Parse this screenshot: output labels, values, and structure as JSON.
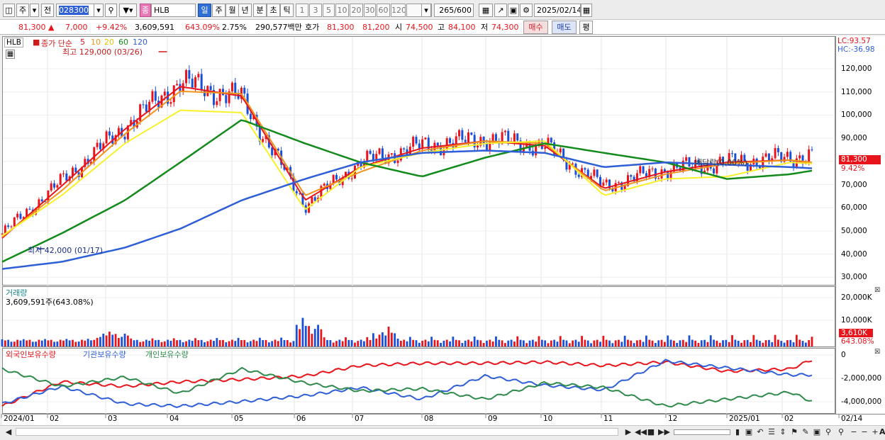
{
  "toolbar": {
    "acct_icon": "window-icon",
    "jugi_label": "주",
    "jeon_label": "전",
    "code_value": "028300",
    "search_icon": "search-icon",
    "zoom_icon": "zoom-icon",
    "speaker_icon": "speaker-icon",
    "badge": "종",
    "name_value": "HLB",
    "period_tabs": [
      {
        "label": "일"
      },
      {
        "label": "주"
      },
      {
        "label": "월"
      },
      {
        "label": "년"
      },
      {
        "label": "분"
      },
      {
        "label": "초"
      },
      {
        "label": "틱"
      }
    ],
    "interval_tabs": [
      {
        "label": "1"
      },
      {
        "label": "3"
      },
      {
        "label": "5"
      },
      {
        "label": "10"
      },
      {
        "label": "20"
      },
      {
        "label": "30"
      },
      {
        "label": "60"
      },
      {
        "label": "120"
      }
    ],
    "count_value": "265",
    "count_total": "/600",
    "date_value": "2025/02/14"
  },
  "quote": {
    "price": "81,300",
    "arrow": "▲",
    "change": "7,000",
    "rate": "+9.42%",
    "volume": "3,609,591",
    "vol_rate": "643.09%",
    "turnover": "2.75%",
    "amount": "290,577백만",
    "hoga_label": "호가",
    "ask": "81,300",
    "bid": "81,200",
    "open_label": "시",
    "open": "74,500",
    "high_label": "고",
    "high": "84,100",
    "low_label": "저",
    "low": "74,300",
    "buy_label": "매수",
    "sell_label": "매도",
    "eval_label": "평"
  },
  "price_panel": {
    "symbol": "HLB",
    "legend_prefix": "종가 단순",
    "ma_periods": [
      "5",
      "10",
      "20",
      "60",
      "120"
    ],
    "max_label": "최고 129,000 (03/26)",
    "min_label": "최저 42,000 (01/17)",
    "dividend_label": "배당락(0.00%)",
    "lc_label": "LC:93.57",
    "hc_label": "HC:-36.98",
    "last_price": "81,300",
    "last_rate": "9.42%",
    "y_labels": [
      "120,000",
      "110,000",
      "100,000",
      "90,000",
      "80,000",
      "70,000",
      "60,000",
      "50,000",
      "40,000",
      "30,000"
    ]
  },
  "volume_panel": {
    "title": "거래량",
    "value_label": "3,609,591주(643.08%)",
    "y_labels": [
      "20,000K",
      "10,000K"
    ],
    "last_k": "3,610K",
    "last_pct": "643.08%"
  },
  "holding_panel": {
    "labels": [
      "외국인보유수량",
      "기관보유수량",
      "개인보유수량"
    ],
    "y_labels": [
      "0",
      "-2,000,000",
      "-4,000,000"
    ]
  },
  "x_labels": [
    "2024/01",
    "02",
    "03",
    "04",
    "05",
    "06",
    "07",
    "08",
    "09",
    "10",
    "11",
    "12",
    "2025/01",
    "02",
    "02/14"
  ],
  "colors": {
    "up": "#e8141c",
    "down": "#1a4fd8",
    "ma5": "#e8141c",
    "ma10": "#f0941c",
    "ma20": "#f8f02a",
    "ma60": "#138a1c",
    "ma120": "#2f5fd6",
    "foreign": "#e8141c",
    "inst": "#2f5fd6",
    "indiv": "#2f8a4c"
  },
  "chart_data": [
    {
      "type": "candlestick",
      "title": "HLB",
      "period": "daily",
      "ylim": [
        26000,
        131000
      ],
      "x": [
        "2024-01-02",
        "2024-02-01",
        "2024-03-04",
        "2024-04-01",
        "2024-05-02",
        "2024-06-03",
        "2024-07-01",
        "2024-08-01",
        "2024-09-02",
        "2024-10-02",
        "2024-11-01",
        "2024-12-02",
        "2025-01-02",
        "2025-02-03",
        "2025-02-14"
      ],
      "close": [
        48000,
        70000,
        93000,
        112000,
        105000,
        60000,
        78000,
        85000,
        88000,
        85000,
        68000,
        75000,
        78000,
        80000,
        81300
      ],
      "ma_series": [
        {
          "name": "5",
          "values": [
            46000,
            68000,
            92000,
            110000,
            106000,
            62000,
            76000,
            84000,
            87000,
            85000,
            67000,
            74000,
            78000,
            79000,
            77500
          ]
        },
        {
          "name": "10",
          "values": [
            46500,
            66000,
            90000,
            108000,
            107000,
            64000,
            74000,
            83000,
            87000,
            86000,
            66000,
            73000,
            77500,
            79000,
            78000
          ]
        },
        {
          "name": "20",
          "values": [
            47000,
            64000,
            86000,
            100000,
            99000,
            58000,
            76000,
            82000,
            86000,
            87000,
            64000,
            71000,
            72000,
            78000,
            77500
          ]
        },
        {
          "name": "60",
          "values": [
            36000,
            48000,
            62000,
            78000,
            96000,
            86000,
            78000,
            72000,
            80000,
            86000,
            82000,
            78000,
            71000,
            73000,
            74500
          ]
        },
        {
          "name": "120",
          "values": [
            33000,
            36000,
            42000,
            50000,
            62000,
            71000,
            78000,
            82000,
            83000,
            82000,
            76000,
            78000,
            77000,
            76000,
            75500
          ]
        }
      ],
      "max": {
        "value": 129000,
        "date": "03/26"
      },
      "min": {
        "value": 42000,
        "date": "01/17"
      }
    },
    {
      "type": "bar",
      "title": "거래량",
      "ylim": [
        0,
        22000000
      ],
      "last": 3609591
    },
    {
      "type": "line",
      "ylim": [
        -5000000,
        500000
      ],
      "series": [
        {
          "name": "외국인보유수량",
          "values": [
            -4400000,
            -2300000,
            -2700000,
            -2300000,
            -2100000,
            -1800000,
            -900000,
            -700000,
            -700000,
            -600000,
            -900000,
            -600000,
            -1400000,
            -1200000,
            -400000
          ]
        },
        {
          "name": "기관보유수량",
          "values": [
            -4200000,
            -2700000,
            -4200000,
            -4400000,
            -4000000,
            -3500000,
            -2800000,
            -3800000,
            -1800000,
            -2600000,
            -3000000,
            -500000,
            -1100000,
            -1700000,
            -1700000
          ]
        },
        {
          "name": "개인보유수량",
          "values": [
            -1200000,
            -2700000,
            -1900000,
            -3300000,
            -1200000,
            -2400000,
            -3100000,
            -2900000,
            -3800000,
            -2400000,
            -2800000,
            -4400000,
            -3800000,
            -3200000,
            -4000000
          ]
        }
      ]
    }
  ]
}
